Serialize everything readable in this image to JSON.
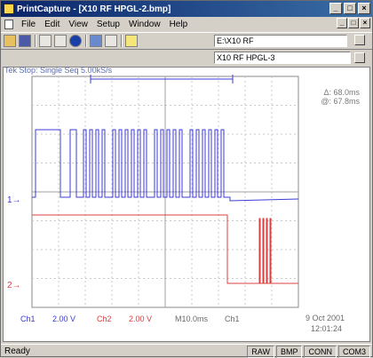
{
  "window": {
    "title": "PrintCapture - [X10 RF HPGL-2.bmp]"
  },
  "titlebar_controls": {
    "minimize": "_",
    "maximize": "□",
    "close": "×"
  },
  "menu": [
    "File",
    "Edit",
    "View",
    "Setup",
    "Window",
    "Help"
  ],
  "toolbar": {
    "icons": [
      "open-icon",
      "save-icon",
      "copy-icon",
      "print-preview-icon",
      "info-icon",
      "settings-icon",
      "print-icon",
      "help-icon"
    ],
    "path_value": "E:\\X10 RF",
    "name_value": "X10 RF HPGL-3"
  },
  "scope": {
    "header": "Tek Stop: Single Seq 5.00kS/s",
    "readout_delta": "Δ: 68.0ms",
    "readout_at": "@: 67.8ms",
    "marker_1": "1",
    "marker_2": "2",
    "footer_ch1": "Ch1",
    "footer_ch1_scale": "2.00 V",
    "footer_ch2": "Ch2",
    "footer_ch2_scale": "2.00 V",
    "footer_time": "M10.0ms",
    "footer_trig": "Ch1",
    "footer_date": "9 Oct 2001",
    "footer_clock": "12:01:24",
    "ch1_color": "#3b3bd8",
    "ch2_color": "#d84040"
  },
  "status": {
    "text": "Ready",
    "panels": [
      "RAW",
      "BMP",
      "CONN",
      "COM3"
    ]
  }
}
